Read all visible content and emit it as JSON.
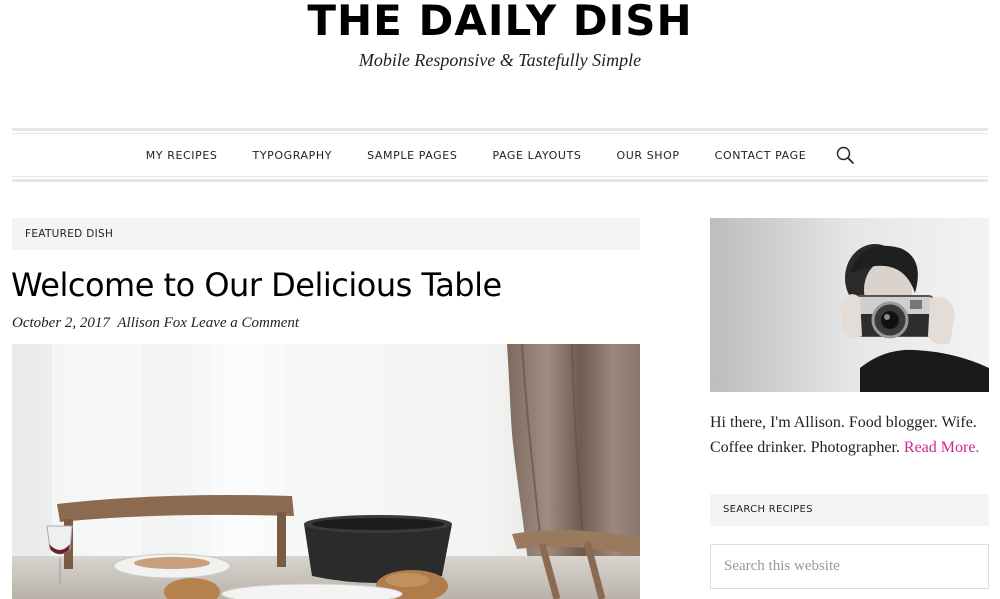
{
  "header": {
    "site_title": "THE DAILY DISH",
    "tagline": "Mobile Responsive & Tastefully Simple"
  },
  "nav": {
    "items": [
      {
        "label": "MY RECIPES"
      },
      {
        "label": "TYPOGRAPHY"
      },
      {
        "label": "SAMPLE PAGES"
      },
      {
        "label": "PAGE LAYOUTS"
      },
      {
        "label": "OUR SHOP"
      },
      {
        "label": "CONTACT PAGE"
      }
    ],
    "search_icon": "search-icon"
  },
  "main": {
    "section_label": "FEATURED DISH",
    "post": {
      "title": "Welcome to Our Delicious Table",
      "date": "October 2, 2017",
      "author": "Allison Fox",
      "comment_link": "Leave a Comment"
    }
  },
  "sidebar": {
    "bio_text": "Hi there, I'm Allison. Food blogger. Wife. Coffee drinker. Photographer.",
    "bio_link": "Read More.",
    "search_label": "SEARCH RECIPES",
    "search_placeholder": "Search this website"
  },
  "colors": {
    "accent": "#d1288a",
    "label_bg": "#f4f4f4",
    "border": "#e6e6e6"
  }
}
